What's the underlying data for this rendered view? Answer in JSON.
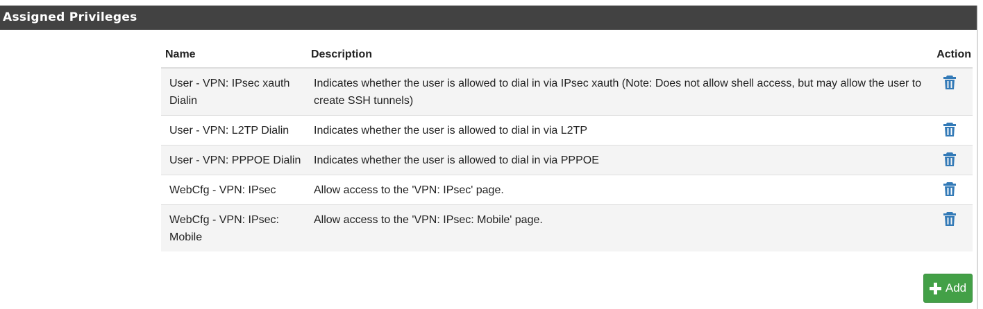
{
  "panel": {
    "title": "Assigned Privileges"
  },
  "table": {
    "headers": {
      "name": "Name",
      "description": "Description",
      "action": "Action"
    },
    "rows": [
      {
        "name": "User - VPN: IPsec xauth Dialin",
        "description": "Indicates whether the user is allowed to dial in via IPsec xauth (Note: Does not allow shell access, but may allow the user to create SSH tunnels)"
      },
      {
        "name": "User - VPN: L2TP Dialin",
        "description": "Indicates whether the user is allowed to dial in via L2TP"
      },
      {
        "name": "User - VPN: PPPOE Dialin",
        "description": "Indicates whether the user is allowed to dial in via PPPOE"
      },
      {
        "name": "WebCfg - VPN: IPsec",
        "description": "Allow access to the 'VPN: IPsec' page."
      },
      {
        "name": "WebCfg - VPN: IPsec: Mobile",
        "description": "Allow access to the 'VPN: IPsec: Mobile' page."
      }
    ],
    "row_action_icon": "trash-icon"
  },
  "add_button": {
    "label": "Add",
    "icon": "plus-icon"
  },
  "colors": {
    "header_bg": "#424242",
    "trash_icon": "#337ab7",
    "add_button_bg": "#43a047",
    "stripe_bg": "#f4f4f4"
  }
}
